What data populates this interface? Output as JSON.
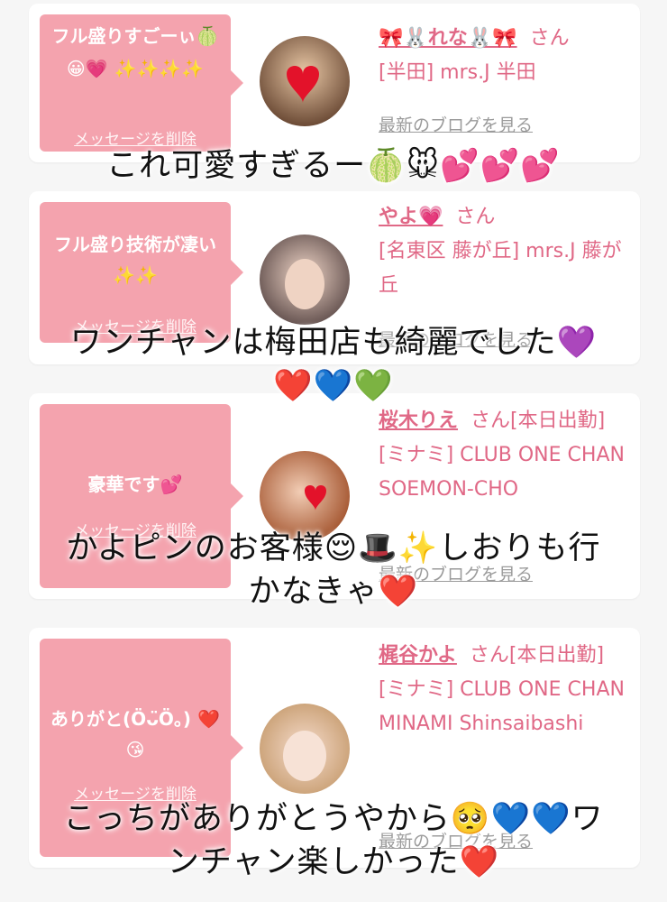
{
  "cards": [
    {
      "message": "フル盛りすごーぃ🍈😀💗 ✨✨✨✨",
      "delete_label": "メッセージを削除",
      "name": "🎀🐰れな🐰🎀",
      "san": "さん",
      "shop": "[半田] mrs.J 半田",
      "blog": "最新のブログを見る"
    },
    {
      "message": "フル盛り技術が凄い✨✨",
      "delete_label": "メッセージを削除",
      "name": "やよ💗",
      "san": "さん",
      "shop": "[名東区 藤が丘] mrs.J 藤が丘",
      "blog": "最新のブログを見る"
    },
    {
      "message": "豪華です💕",
      "delete_label": "メッセージを削除",
      "name": "桜木りえ",
      "san": "さん[本日出勤]",
      "shop": "[ミナミ] CLUB ONE CHAN SOEMON-CHO",
      "blog": "最新のブログを見る"
    },
    {
      "message": "ありがと(Öᴗ̈Ö。) ❤️😘",
      "delete_label": "メッセージを削除",
      "name": "梶谷かよ",
      "san": "さん[本日出勤]",
      "shop": "[ミナミ] CLUB ONE CHAN MINAMI Shinsaibashi",
      "blog": "最新のブログを見る"
    }
  ],
  "overlays": [
    "これ可愛すぎるー🍈🐭💕💕💕",
    "ワンチャンは梅田店も綺麗でした💜",
    "❤️💙💚",
    "かよピンのお客様😌🎩✨しおりも行",
    "かなきゃ❤️",
    "こっちがありがとうやから🥺💙💙ワ",
    "ンチャン楽しかった❤️"
  ],
  "colors": {
    "accent_pink": "#f4a3ae",
    "name_pink": "#e06886",
    "background": "#f6f6f6"
  }
}
